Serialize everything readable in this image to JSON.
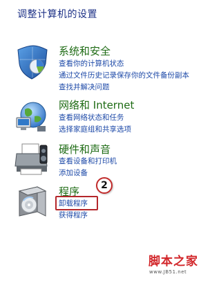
{
  "page": {
    "title": "调整计算机的设置"
  },
  "categories": [
    {
      "title": "系统和安全",
      "icon": "shield-icon",
      "links": [
        "查看你的计算机状态",
        "通过文件历史记录保存你的文件备份副本",
        "查找并解决问题"
      ]
    },
    {
      "title": "网络和 Internet",
      "icon": "network-globe-icon",
      "links": [
        "查看网络状态和任务",
        "选择家庭组和共享选项"
      ]
    },
    {
      "title": "硬件和声音",
      "icon": "printer-icon",
      "links": [
        "查看设备和打印机",
        "添加设备"
      ]
    },
    {
      "title": "程序",
      "icon": "programs-box-icon",
      "links": [
        "卸载程序",
        "获得程序"
      ]
    }
  ],
  "annotation": {
    "step": "2"
  },
  "watermark": {
    "main": "脚本之家",
    "sub": "www.JB51.net"
  },
  "colors": {
    "title": "#1e3287",
    "category": "#1e6b14",
    "link": "#1e4aa8",
    "highlight": "#b4262b"
  }
}
